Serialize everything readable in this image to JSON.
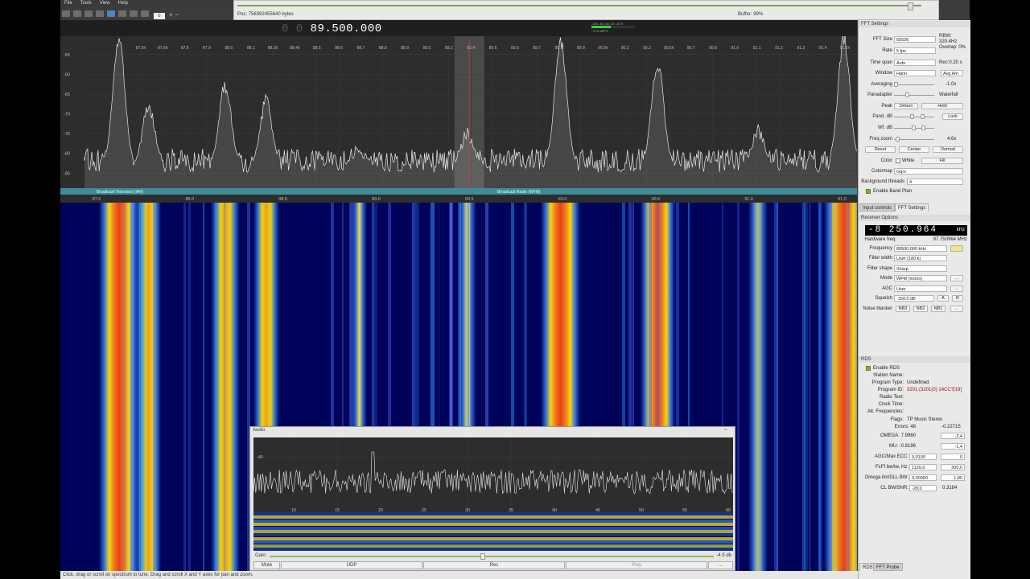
{
  "menu": [
    "File",
    "Tools",
    "View",
    "Help"
  ],
  "toolbar_icons": [
    "start-icon",
    "stop-icon",
    "open-icon",
    "save-icon",
    "device-icon",
    "config-icon",
    "tools-icon",
    "fullscreen-icon",
    "zoom-icon"
  ],
  "toolbar": {
    "value": "0",
    "plus": "+",
    "minus": "−"
  },
  "file_player": {
    "position": "Pos: 756392455640 bytes",
    "buffer": "Buffer: 99%",
    "progress": 0.98
  },
  "frequency": {
    "dim": "0 0",
    "value": "89.500.000"
  },
  "meter": {
    "labels": "-100 -80 -60 -40 -20 0",
    "unit": "-70.8 dBFS"
  },
  "spectrum": {
    "y_ticks": [
      "-55",
      "-60",
      "-65",
      "-70",
      "-75",
      "-80",
      "-85"
    ],
    "top_ticks": [
      "87.5h",
      "87.6h",
      "87.8",
      "87.9",
      "88.0",
      "88.1",
      "88.3h",
      "88.4h",
      "88.5",
      "88.6",
      "88.7",
      "88.8",
      "88.9",
      "89.0",
      "89.2",
      "89.4",
      "89.5",
      "89.6",
      "89.7",
      "89.8",
      "89.9",
      "90.0h",
      "90.2",
      "90.3",
      "90.5h",
      "90.7",
      "90.8",
      "91.0",
      "91.1",
      "91.2",
      "91.3",
      "91.4",
      "91.5h"
    ],
    "bottom_ticks": [
      "87.5",
      "88.0",
      "88.5",
      "89.0",
      "89.5",
      "90.0",
      "90.5",
      "91.0",
      "91.5"
    ],
    "band_plan": [
      "Broadcast Television (AM)",
      "Broadcast Radio (WFM)"
    ],
    "freq_range": [
      87.5,
      91.55
    ],
    "peaks": [
      {
        "f": 87.62,
        "level": -51
      },
      {
        "f": 87.78,
        "level": -68
      },
      {
        "f": 88.19,
        "level": -63
      },
      {
        "f": 88.41,
        "level": -67
      },
      {
        "f": 88.91,
        "level": -79
      },
      {
        "f": 89.49,
        "level": -75
      },
      {
        "f": 89.99,
        "level": -52
      },
      {
        "f": 90.51,
        "level": -57
      },
      {
        "f": 91.05,
        "level": -74
      },
      {
        "f": 91.51,
        "level": -51
      }
    ],
    "noise_floor": -83
  },
  "status": "Click, drag or scroll on spectrum to tune. Drag and scroll X and Y axes for pan and zoom.",
  "fft": {
    "title": "FFT Settings",
    "fft_size_label": "FFT Size",
    "fft_size": "65536",
    "rbw": "RBW: 320.4Hz",
    "rate_label": "Rate",
    "rate": "5 fps",
    "overlap": "Overlap: 0%",
    "timespan_label": "Time span",
    "timespan": "Auto",
    "rec": "Rec:0.20 s",
    "window_label": "Window",
    "window": "Hann",
    "avg": "Avg Am",
    "averaging_label": "Averaging",
    "averaging_val": "-1.0x",
    "averaging_pos": 0.0,
    "panadapter_label": "Panadapter",
    "waterfall_label": "Waterfall",
    "pand_split": 0.3,
    "peak_label": "Peak",
    "detect": "Detect",
    "hold": "Hold",
    "pand_db_label": "Pand. dB",
    "lock": "Lock",
    "wf_db_label": "Wf. dB",
    "freqzoom_label": "Freq zoom",
    "freqzoom_val": "4.6x",
    "freqzoom_pos": 0.05,
    "reset": "Reset",
    "center": "Center",
    "demod": "Demod",
    "color_label": "Color",
    "white": "White",
    "fill": "Fill",
    "colormap_label": "Colormap",
    "colormap": "Gqrx",
    "bgthreads_label": "Background threads",
    "bgthreads": "4",
    "bandplan": "Enable Band Plan"
  },
  "tabs_mid": [
    "Input controls",
    "FFT Settings"
  ],
  "receiver": {
    "title": "Receiver Options",
    "lcd": "-8 250.964",
    "lcd_unit": "kHz",
    "hwfreq_label": "Hardware freq:",
    "hwfreq": "97.750964 MHz",
    "frequency_label": "Frequency",
    "frequency": "89500.000 kHz",
    "fw_label": "Filter width",
    "fw": "User (180 k)",
    "fs_label": "Filter shape",
    "fs": "Sharp",
    "mode_label": "Mode",
    "mode": "WFM (mono)",
    "agc_label": "AGC",
    "agc": "User",
    "squelch_label": "Squelch",
    "squelch": "-150.0 dB",
    "sq_a": "A",
    "sq_r": "R",
    "nb_label": "Noise blanker",
    "nb3": "NB3",
    "nb2": "NB2",
    "nb1": "NB1",
    "dots": "..."
  },
  "rds": {
    "title": "RDS",
    "enable": "Enable RDS",
    "station_label": "Station Name:",
    "station": "",
    "ptype_label": "Program Type:",
    "ptype": "Undefined",
    "pid_label": "Program ID:",
    "pid": "3201 (3201(0) 14CC?[19]",
    "radiotext_label": "Radio Text:",
    "clock_label": "Clock Time:",
    "altfreq_label": "Alt. Frequencies:",
    "flags_label": "Flags:",
    "flags": "TP Music Stereo",
    "errors_label": "Errors: 48",
    "errors_val": "-0.22715",
    "omega_label": "OMEGA: 7.9960",
    "omega_val": "-2,4",
    "mu_label": "MU: -0.8196",
    "mu_val": "-1,4",
    "agc_label": "AGC/Max ECC:",
    "agc_a": "0,0100",
    "agc_b": "0",
    "fxff_label": "FxFf bw/tw, Hz:",
    "fxff_a": "1120,0",
    "fxff_b": "300,0",
    "omega_lim_label": "Omega lim/DLL BW:",
    "omega_lim_a": "0,00050",
    "omega_lim_b": "1,80",
    "cl_label": "CL BW/SNR:",
    "cl_a": "-28,0",
    "cl_b": "0.3184"
  },
  "tabs_bottom": [
    "RDS",
    "FFT Probe"
  ],
  "audio": {
    "title": "Audio",
    "y_tick": "-40",
    "x_ticks": [
      "10",
      "15",
      "20",
      "25",
      "30",
      "35",
      "40",
      "45",
      "50",
      "55",
      "60"
    ],
    "gain_label": "Gain:",
    "gain_val": "-4.5 db",
    "gain_pos": 0.48,
    "buttons": [
      "Mute",
      "UDP",
      "Rec",
      "Play",
      "..."
    ]
  }
}
